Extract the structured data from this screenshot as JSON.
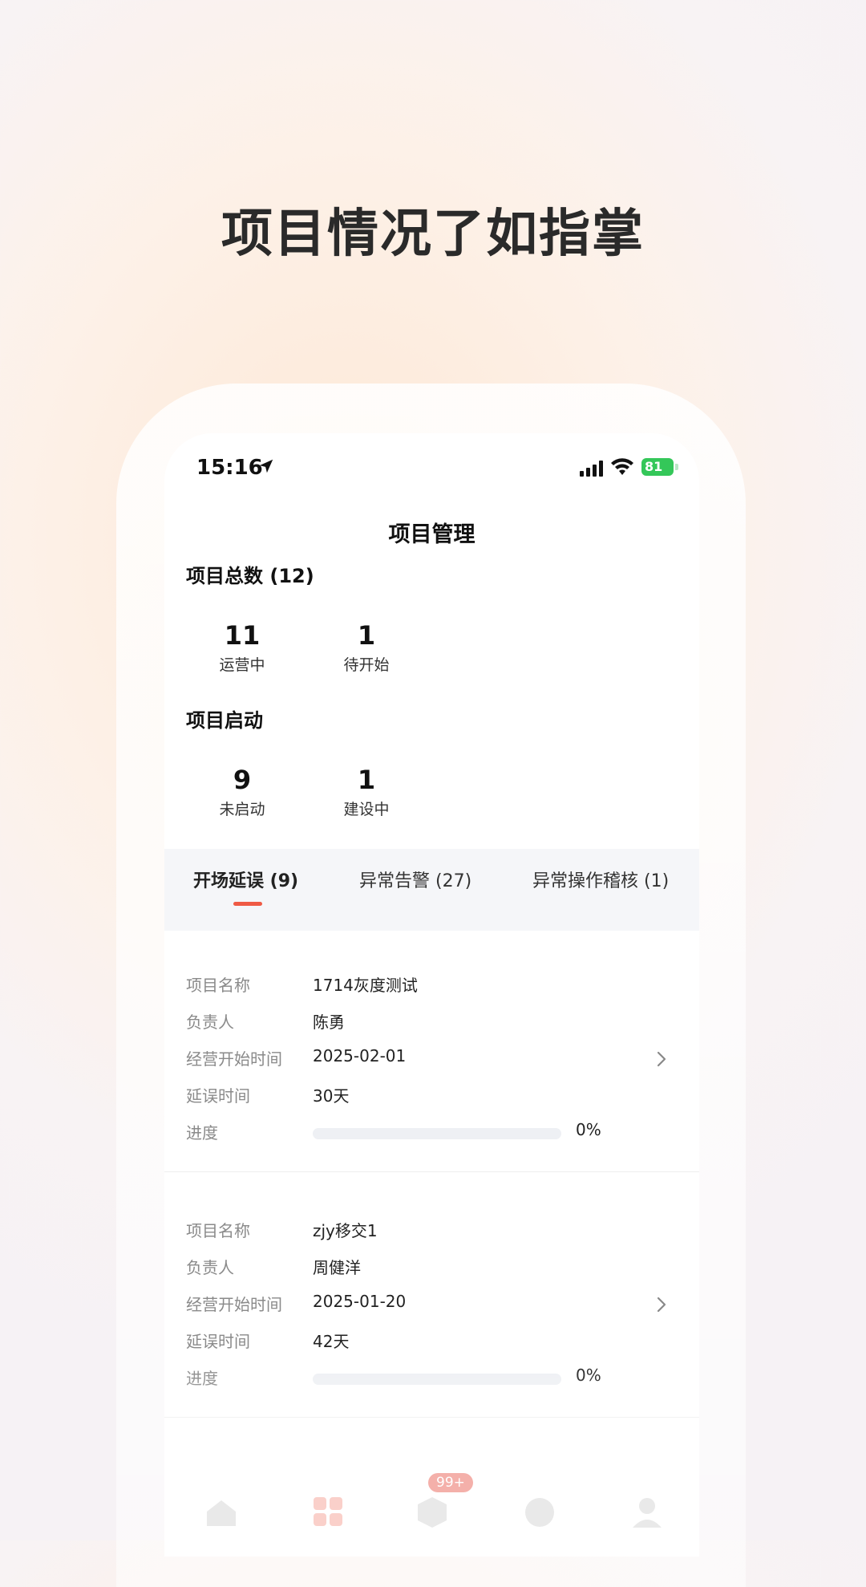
{
  "headline": "项目情况了如指掌",
  "status_bar": {
    "time": "15:16",
    "battery": "81"
  },
  "page_title": "项目管理",
  "totals": {
    "title": "项目总数 (12)",
    "stats": [
      {
        "value": "11",
        "label": "运营中"
      },
      {
        "value": "1",
        "label": "待开始"
      }
    ]
  },
  "launch": {
    "title": "项目启动",
    "stats": [
      {
        "value": "9",
        "label": "未启动"
      },
      {
        "value": "1",
        "label": "建设中"
      }
    ]
  },
  "tabs": [
    {
      "label": "开场延误 (9)",
      "active": true
    },
    {
      "label": "异常告警 (27)",
      "active": false
    },
    {
      "label": "异常操作稽核 (1)",
      "active": false
    }
  ],
  "projects": [
    {
      "name_label": "项目名称",
      "name": "1714灰度测试",
      "owner_label": "负责人",
      "owner": "陈勇",
      "start_label": "经营开始时间",
      "start": "2025-02-01",
      "delay_label": "延误时间",
      "delay": "30天",
      "progress_label": "进度",
      "progress": "0%",
      "progress_value": 0
    },
    {
      "name_label": "项目名称",
      "name": "zjy移交1",
      "owner_label": "负责人",
      "owner": "周健洋",
      "start_label": "经营开始时间",
      "start": "2025-01-20",
      "delay_label": "延误时间",
      "delay": "42天",
      "progress_label": "进度",
      "progress": "0%",
      "progress_value": 0
    }
  ],
  "tabbar": {
    "badge": "99+",
    "icons": [
      "home-icon",
      "grid-icon",
      "box-icon",
      "chart-icon",
      "user-icon"
    ]
  },
  "colors": {
    "accent": "#ef5a45",
    "battery": "#34c759"
  }
}
